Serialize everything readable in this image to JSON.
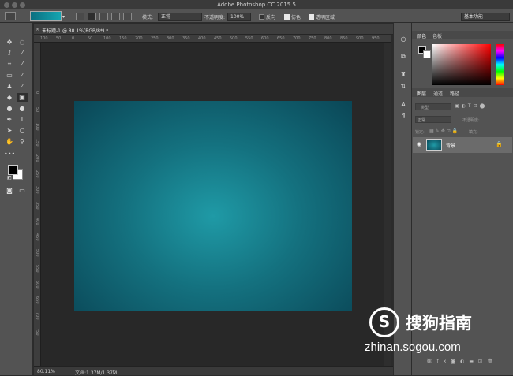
{
  "window": {
    "title": "Adobe Photoshop CC 2015.5"
  },
  "options_bar": {
    "mode_label": "模式:",
    "mode_value": "正常",
    "opacity_label": "不透明度:",
    "opacity_value": "100%",
    "reverse_label": "反向",
    "dither_label": "仿色",
    "transparency_label": "透明区域",
    "workspace_value": "基本功能"
  },
  "document": {
    "tab_label": "未标题-1 @ 80.1%(RGB/8*) *",
    "canvas_gradient": {
      "center": "#1f9aa6",
      "mid": "#14717f",
      "edge": "#0a4656"
    }
  },
  "ruler": {
    "top_ticks": [
      "100",
      "50",
      "0",
      "50",
      "100",
      "150",
      "200",
      "250",
      "300",
      "350",
      "400",
      "450",
      "500",
      "550",
      "600",
      "650",
      "700",
      "750",
      "800",
      "850",
      "900",
      "950"
    ],
    "left_ticks": [
      "0",
      "50",
      "100",
      "150",
      "200",
      "250",
      "300",
      "350",
      "400",
      "450",
      "500",
      "550",
      "600",
      "650",
      "700",
      "750"
    ]
  },
  "status": {
    "zoom": "80.11%",
    "doc_info": "文档:1.37M/1.37M"
  },
  "color_panel": {
    "tabs": [
      "颜色",
      "色板"
    ]
  },
  "layers_panel": {
    "tabs": [
      "图层",
      "通道",
      "路径"
    ],
    "filter_kind": "类型",
    "blend_mode": "正常",
    "opacity_label": "不透明度:",
    "lock_label": "锁定:",
    "fill_label": "填充:",
    "layer_name": "背景"
  },
  "watermark": {
    "logo": "S",
    "name": "搜狗指南",
    "url": "zhinan.sogou.com"
  },
  "colors": {
    "ui_bg": "#535353",
    "canvas_bg": "#282828",
    "foreground": "#000000",
    "background": "#ffffff"
  }
}
